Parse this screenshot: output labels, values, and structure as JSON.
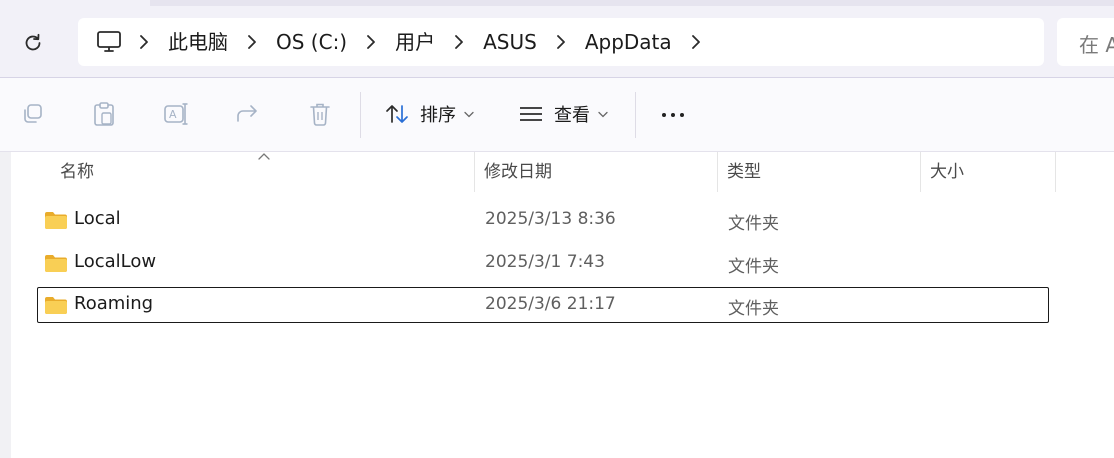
{
  "breadcrumb": {
    "items": [
      "此电脑",
      "OS (C:)",
      "用户",
      "ASUS",
      "AppData"
    ]
  },
  "search": {
    "placeholder": "在 A"
  },
  "toolbar": {
    "sort_label": "排序",
    "view_label": "查看"
  },
  "columns": {
    "name": "名称",
    "modified": "修改日期",
    "type": "类型",
    "size": "大小"
  },
  "files": [
    {
      "name": "Local",
      "modified": "2025/3/13 8:36",
      "type": "文件夹",
      "size": "",
      "selected": false
    },
    {
      "name": "LocalLow",
      "modified": "2025/3/1 7:43",
      "type": "文件夹",
      "size": "",
      "selected": false
    },
    {
      "name": "Roaming",
      "modified": "2025/3/6 21:17",
      "type": "文件夹",
      "size": "",
      "selected": true
    }
  ],
  "colors": {
    "topbar_bg": "#f2f1f8",
    "folder_yellow": "#f7c948",
    "selected_border": "#1a1a1a",
    "disabled_icon": "#9aa6b8",
    "sort_icon_blue": "#2a6fd6"
  },
  "icons": {
    "refresh": "refresh-icon",
    "this_pc": "monitor-icon",
    "copy": "copy-icon",
    "paste": "paste-icon",
    "rename": "rename-icon",
    "share": "share-icon",
    "delete": "trash-icon",
    "sort": "sort-arrows-icon",
    "view": "list-view-icon",
    "more": "more-horizontal-icon",
    "folder": "folder-icon"
  }
}
